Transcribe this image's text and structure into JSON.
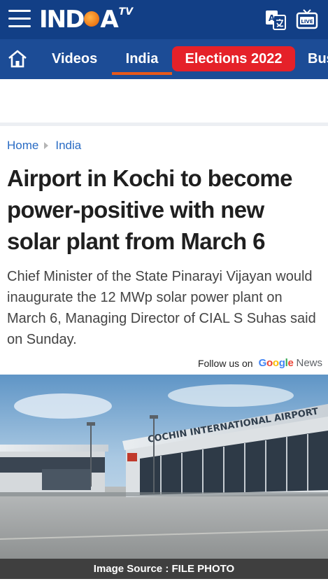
{
  "header": {
    "logo_text": "INDIA",
    "logo_suffix": "TV",
    "icons": [
      "menu-icon",
      "translate-icon",
      "live-tv-icon"
    ]
  },
  "nav": {
    "home_icon": "home-icon",
    "items": [
      {
        "label": "Videos"
      },
      {
        "label": "India",
        "active": true
      },
      {
        "label": "Elections 2022",
        "highlight": "#e52129"
      },
      {
        "label": "Bus"
      }
    ]
  },
  "breadcrumb": {
    "home": "Home",
    "section": "India"
  },
  "article": {
    "headline": "Airport in Kochi to become power-positive with new solar plant from March 6",
    "summary": "Chief Minister of the State Pinarayi Vijayan would inaugurate the 12 MWp solar power plant on March 6, Managing Director of CIAL S Suhas said on Sunday.",
    "follow_label": "Follow us on",
    "follow_brand": "Google",
    "follow_brand_suffix": "News",
    "image_caption": "Image Source : FILE PHOTO",
    "image_sign_text": "COCHIN INTERNATIONAL AIRPORT"
  },
  "colors": {
    "header_bg": "#123f86",
    "nav_bg": "#1c4c96",
    "active_underline": "#e8591a",
    "elections_bg": "#e52129",
    "link": "#2a6cc4"
  }
}
